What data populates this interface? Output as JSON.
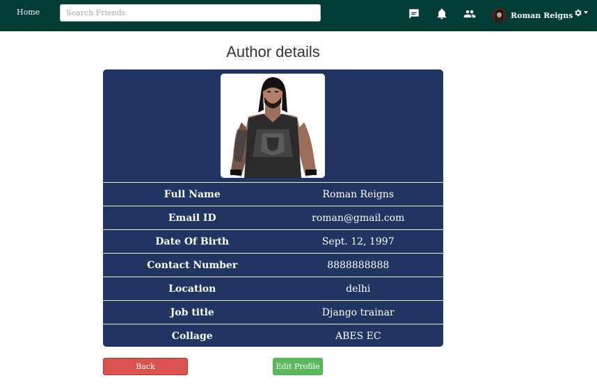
{
  "navbar": {
    "home_label": "Home",
    "search_placeholder": "Search Friends",
    "user_name": "Roman Reigns",
    "icons": [
      "message-icon",
      "bell-icon",
      "friends-icon",
      "gear-icon"
    ]
  },
  "page": {
    "title": "Author details"
  },
  "profile": {
    "rows": [
      {
        "label": "Full Name",
        "value": "Roman Reigns"
      },
      {
        "label": "Email ID",
        "value": "roman@gmail.com"
      },
      {
        "label": "Date Of Birth",
        "value": "Sept. 12, 1997"
      },
      {
        "label": "Contact Number",
        "value": "8888888888"
      },
      {
        "label": "Location",
        "value": "delhi"
      },
      {
        "label": "Job title",
        "value": "Django trainar"
      },
      {
        "label": "Collage",
        "value": "ABES EC"
      }
    ]
  },
  "actions": {
    "back_label": "Back",
    "edit_label": "Edit Profile"
  },
  "colors": {
    "navbar_bg": "#013d35",
    "card_bg": "#213562",
    "back_button": "#d9534f",
    "edit_button": "#5cb85c"
  }
}
